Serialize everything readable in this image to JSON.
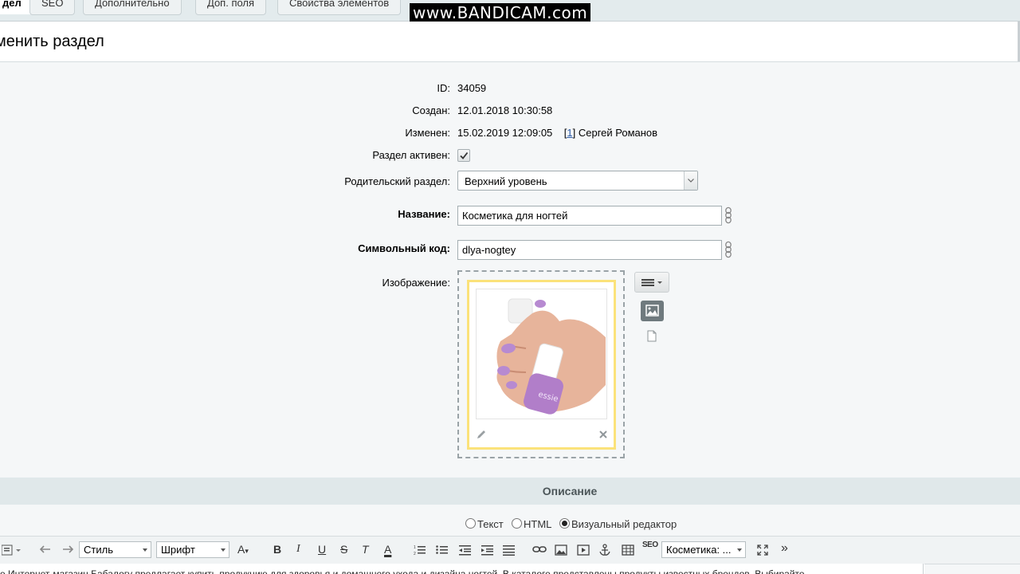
{
  "tabs": [
    {
      "label": "дел",
      "active": true
    },
    {
      "label": "SEO",
      "active": false
    },
    {
      "label": "Дополнительно",
      "active": false
    },
    {
      "label": "Доп. поля",
      "active": false
    },
    {
      "label": "Свойства элементов",
      "active": false
    }
  ],
  "watermark": "www.BANDICAM.com",
  "page_title": "менить раздел",
  "form": {
    "id_label": "ID:",
    "id_value": "34059",
    "created_label": "Создан:",
    "created_value": "12.01.2018 10:30:58",
    "modified_label": "Изменен:",
    "modified_value": "15.02.2019 12:09:05",
    "modified_user_open": "[",
    "modified_user_id": "1",
    "modified_user_close": "]",
    "modified_user_name": "Сергей Романов",
    "active_label": "Раздел активен:",
    "active_checked": true,
    "parent_label": "Родительский раздел:",
    "parent_value": "Верхний уровень",
    "name_label": "Название:",
    "name_value": "Косметика для ногтей",
    "code_label": "Символьный код:",
    "code_value": "dlya-nogtey",
    "image_label": "Изображение:"
  },
  "description": {
    "title": "Описание",
    "modes": [
      {
        "label": "Текст",
        "selected": false
      },
      {
        "label": "HTML",
        "selected": false
      },
      {
        "label": "Визуальный редактор",
        "selected": true
      }
    ]
  },
  "toolbar": {
    "style_label": "Стиль",
    "font_label": "Шрифт",
    "size_label": "A",
    "bold": "B",
    "italic": "I",
    "underline": "U",
    "strike": "S",
    "clear": "T",
    "color": "A",
    "seo": "SEO",
    "snippet_select": "Косметика: ...",
    "more": "»"
  },
  "editor_text": "е Интернет-магазин Бабалогу предлагает купить продукцию для здоровья и домашнего ухода и дизайна ногтей. В каталоге представлены продукты известных брендов. Выбирайте"
}
